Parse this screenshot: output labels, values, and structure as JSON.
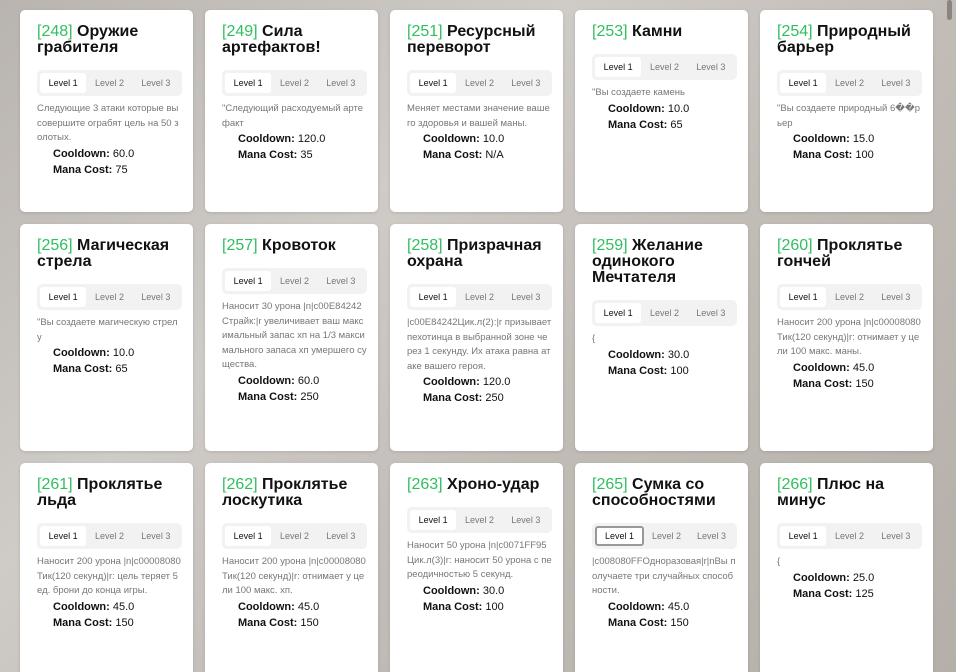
{
  "labels": {
    "cooldown": "Cooldown:",
    "mana": "Mana Cost:",
    "levels": [
      "Level 1",
      "Level 2",
      "Level 3"
    ]
  },
  "cards": [
    {
      "id": "[248]",
      "name": "Оружие грабителя",
      "desc": "Следующие 3 атаки которые вы совершите ограбят цель на 50 золотых.",
      "cooldown": "60.0",
      "mana": "75"
    },
    {
      "id": "[249]",
      "name": "Сила артефактов!",
      "desc": "\"Следующий расходуемый артефакт",
      "cooldown": "120.0",
      "mana": "35"
    },
    {
      "id": "[251]",
      "name": "Ресурсный переворот",
      "desc": "Меняет местами значение вашего здоровья и вашей маны.",
      "cooldown": "10.0",
      "mana": "N/A"
    },
    {
      "id": "[253]",
      "name": "Камни",
      "desc": "\"Вы создаете камень",
      "cooldown": "10.0",
      "mana": "65"
    },
    {
      "id": "[254]",
      "name": "Природный барьер",
      "desc": "\"Вы создаете природный 6��рьер",
      "cooldown": "15.0",
      "mana": "100"
    },
    {
      "id": "[256]",
      "name": "Магическая стрела",
      "desc": "\"Вы создаете магическую стрелу",
      "cooldown": "10.0",
      "mana": "65"
    },
    {
      "id": "[257]",
      "name": "Кровоток",
      "desc": "Наносит 30 урона |n|c00E84242Страйк:|r увеличивает ваш максимальный запас хп на 1/3 максимального запаса хп умершего существа.",
      "cooldown": "60.0",
      "mana": "250"
    },
    {
      "id": "[258]",
      "name": "Призрачная охрана",
      "desc": "|c00E84242Цик.л(2):|r призывает пехотинца в выбранной зоне через 1 секунду. Их атака равна атаке вашего героя.",
      "cooldown": "120.0",
      "mana": "250"
    },
    {
      "id": "[259]",
      "name": "Желание одинокого Мечтателя",
      "desc": "{",
      "cooldown": "30.0",
      "mana": "100"
    },
    {
      "id": "[260]",
      "name": "Проклятье гончей",
      "desc": "Наносит 200 урона |n|c00008080Тик(120 секунд)|r: отнимает у цели 100 макс. маны.",
      "cooldown": "45.0",
      "mana": "150"
    },
    {
      "id": "[261]",
      "name": "Проклятье льда",
      "desc": "Наносит 200 урона |n|c00008080Тик(120 секунд)|r: цель теряет 5 ед. брони до конца игры.",
      "cooldown": "45.0",
      "mana": "150"
    },
    {
      "id": "[262]",
      "name": "Проклятье лоскутика",
      "desc": "Наносит 200 урона |n|c00008080Тик(120 секунд)|r: отнимает у цели 100 макс. хп.",
      "cooldown": "45.0",
      "mana": "150"
    },
    {
      "id": "[263]",
      "name": "Хроно-удар",
      "desc": "Наносит 50 урона |n|c0071FF95Цик.л(3)|r: наносит 50 урона с переодичностью 5 секунд.",
      "cooldown": "30.0",
      "mana": "100"
    },
    {
      "id": "[265]",
      "name": "Сумка со способностями",
      "desc": "|c008080FFОдноразовая|r|nВы получаете три случайных способности.",
      "cooldown": "45.0",
      "mana": "150"
    },
    {
      "id": "[266]",
      "name": "Плюс на минус",
      "desc": "{",
      "cooldown": "25.0",
      "mana": "125"
    }
  ]
}
